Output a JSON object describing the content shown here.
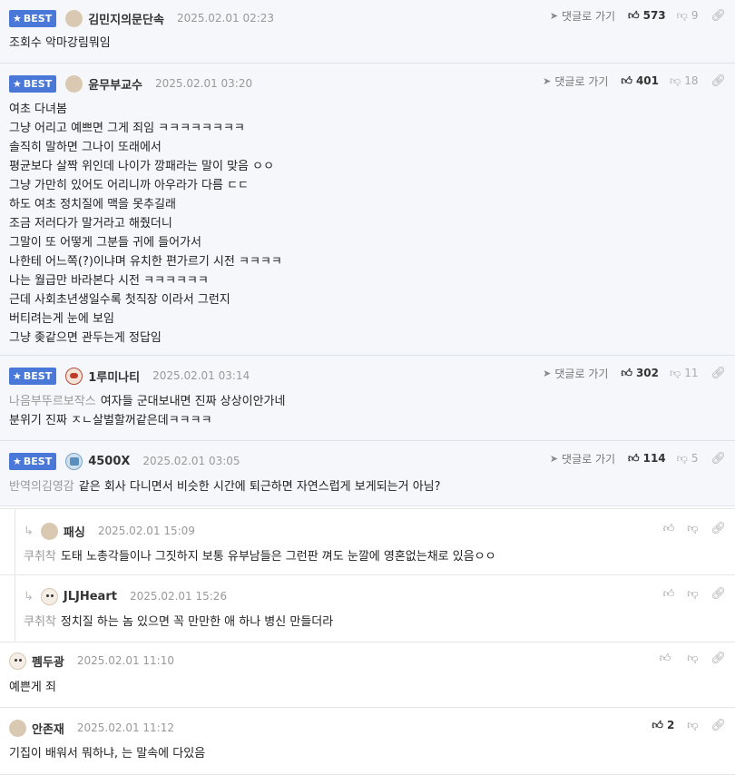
{
  "comments": [
    {
      "badge": "BEST",
      "nick": "김민지의문단속",
      "date": "2025.02.01 02:23",
      "goto": "댓글로 가기",
      "up": "573",
      "down": "9",
      "quote": "",
      "lines": [
        "조회수 악마강림뭐임"
      ]
    },
    {
      "badge": "BEST",
      "nick": "윤무부교수",
      "date": "2025.02.01 03:20",
      "goto": "댓글로 가기",
      "up": "401",
      "down": "18",
      "quote": "",
      "lines": [
        "여초 다녀봄",
        "그냥 어리고 예쁘면 그게 죄임 ㅋㅋㅋㅋㅋㅋㅋㅋ",
        "솔직히 말하면 그나이 또래에서",
        "평균보다 살짝 위인데 나이가 깡패라는 말이 맞음 ㅇㅇ",
        "그냥 가만히 있어도 어리니까 아우라가 다름 ㄷㄷ",
        "하도 여초 정치질에 맥을 못추길래",
        "조금 저러다가 말거라고 해줬더니",
        "그말이 또 어떻게 그분들 귀에 들어가서",
        "나한테 어느쪽(?)이냐며 유치한 편가르기 시전 ㅋㅋㅋㅋ",
        "나는 월급만 바라본다 시전 ㅋㅋㅋㅋㅋㅋ",
        "근데 사회초년생일수록 첫직장 이라서 그런지",
        "버티려는게 눈에 보임",
        "그냥 좆같으면 관두는게 정답임"
      ]
    },
    {
      "badge": "BEST",
      "nick": "1루미나티",
      "date": "2025.02.01 03:14",
      "goto": "댓글로 가기",
      "up": "302",
      "down": "11",
      "quote": "나음부뚜르보작스",
      "lines": [
        "여자들 군대보내면 진짜 상상이안가네",
        "분위기 진짜 ㅈㄴ살벌할꺼같은데ㅋㅋㅋㅋ"
      ]
    },
    {
      "badge": "BEST",
      "nick": "4500X",
      "date": "2025.02.01 03:05",
      "goto": "댓글로 가기",
      "up": "114",
      "down": "5",
      "quote": "반역의김영감",
      "lines": [
        "같은 회사 다니면서 비슷한 시간에 퇴근하면 자연스럽게 보게되는거 아님?"
      ]
    }
  ],
  "replies": [
    {
      "nick": "패싱",
      "date": "2025.02.01 15:09",
      "quote": "쿠취착",
      "text": "도태 노총각들이나 그짓하지 보통 유부남들은 그런판 껴도 눈깔에 영혼없는채로 있음ㅇㅇ"
    },
    {
      "nick": "JLJHeart",
      "date": "2025.02.01 15:26",
      "quote": "쿠취착",
      "text": "정치질 하는 놈 있으면 꼭 만만한 애 하나 병신 만들더라"
    }
  ],
  "plain": [
    {
      "nick": "펨두광",
      "date": "2025.02.01 11:10",
      "up": "",
      "text": "예쁜게 죄"
    },
    {
      "nick": "안존재",
      "date": "2025.02.01 11:12",
      "up": "2",
      "text": "기집이 배워서 뭐하냐, 는 말속에 다있음"
    }
  ],
  "icons": {
    "best_star": "star-icon",
    "goto": "send-arrow-icon",
    "up": "thumbs-up-icon",
    "down": "thumbs-down-icon",
    "link": "link-icon",
    "reply": "reply-arrow-icon"
  },
  "colors": {
    "badge": "#4a78d8",
    "best_bg": "#f5f7fb",
    "muted": "#999999"
  }
}
